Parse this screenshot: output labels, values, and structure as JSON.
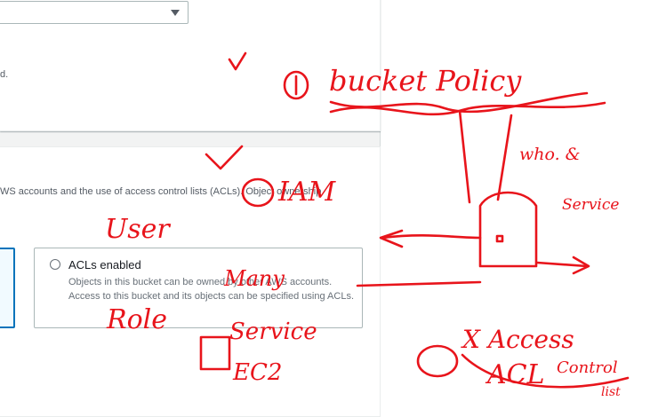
{
  "top_section": {
    "select_value": "",
    "trailing_text": "d."
  },
  "object_ownership": {
    "description": "WS accounts and the use of access control lists (ACLs). Object ownership",
    "acl_tile": {
      "label": "ACLs enabled",
      "description": "Objects in this bucket can be owned by other AWS accounts. Access to this bucket and its objects can be specified using ACLs."
    }
  },
  "annotations": {
    "ink_color": "#e8141b",
    "notes": [
      "bucket Policy",
      "who. &",
      "Service",
      "IAM",
      "User",
      "Many",
      "Role",
      "Service",
      "EC2",
      "X Access",
      "ACL",
      "Control",
      "list"
    ]
  }
}
